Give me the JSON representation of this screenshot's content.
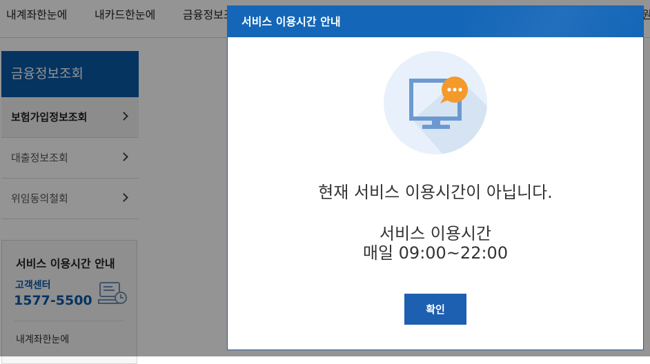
{
  "topnav": {
    "items": [
      "내계좌한눈에",
      "내카드한눈에",
      "금융정보조회",
      "원"
    ]
  },
  "sidebar": {
    "title": "금융정보조회",
    "items": [
      {
        "label": "보험가입정보조회",
        "active": true
      },
      {
        "label": "대출정보조회",
        "active": false
      },
      {
        "label": "위임동의철회",
        "active": false
      }
    ]
  },
  "infobox": {
    "title": "서비스 이용시간 안내",
    "cc_label": "고객센터",
    "cc_phone": "1577-5500",
    "link": "내계좌한눈에"
  },
  "modal": {
    "title": "서비스 이용시간 안내",
    "message": "현재 서비스 이용시간이 아닙니다.",
    "hours_label": "서비스 이용시간",
    "hours_value": "매일 09:00~22:00",
    "confirm_label": "확인",
    "icon": "monitor-chat-icon"
  },
  "colors": {
    "primary": "#1466b8",
    "sidebar_header": "#0b5ba8",
    "speech_bubble": "#f39a2b"
  }
}
